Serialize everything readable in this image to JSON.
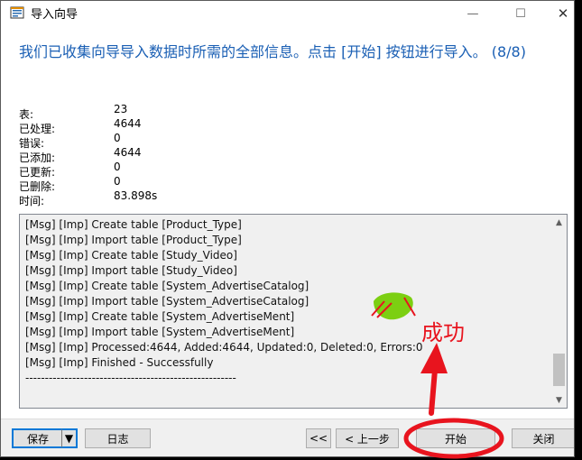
{
  "window": {
    "title": "导入向导",
    "controls": {
      "minimize": "—",
      "maximize": "☐",
      "close": "✕"
    }
  },
  "header": {
    "text": "我们已收集向导导入数据时所需的全部信息。点击 [开始] 按钮进行导入。 (8/8)"
  },
  "stats": [
    {
      "label": "表:",
      "value": "23"
    },
    {
      "label": "已处理:",
      "value": "4644"
    },
    {
      "label": "错误:",
      "value": "0"
    },
    {
      "label": "已添加:",
      "value": "4644"
    },
    {
      "label": "已更新:",
      "value": "0"
    },
    {
      "label": "已删除:",
      "value": "0"
    },
    {
      "label": "时间:",
      "value": "83.898s"
    }
  ],
  "log": {
    "lines": [
      "[Msg] [Imp] Create table [Product_Type]",
      "[Msg] [Imp] Import table [Product_Type]",
      "[Msg] [Imp] Create table [Study_Video]",
      "[Msg] [Imp] Import table [Study_Video]",
      "[Msg] [Imp] Create table [System_AdvertiseCatalog]",
      "[Msg] [Imp] Import table [System_AdvertiseCatalog]",
      "[Msg] [Imp] Create table [System_AdvertiseMent]",
      "[Msg] [Imp] Import table [System_AdvertiseMent]",
      "[Msg] [Imp] Processed:4644, Added:4644, Updated:0, Deleted:0, Errors:0",
      "[Msg] [Imp] Finished - Successfully",
      "------------------------------------------------------"
    ]
  },
  "buttons": {
    "save": "保存",
    "save_arrow": "▼",
    "log": "日志",
    "first": "<<",
    "prev": "< 上一步",
    "start": "开始",
    "close": "关闭"
  },
  "annotation": {
    "text": "成功",
    "color": "#e8141e"
  },
  "icons": {
    "app": "import-wizard-icon",
    "scroll_up": "chevron-up-icon",
    "scroll_down": "chevron-down-icon"
  }
}
